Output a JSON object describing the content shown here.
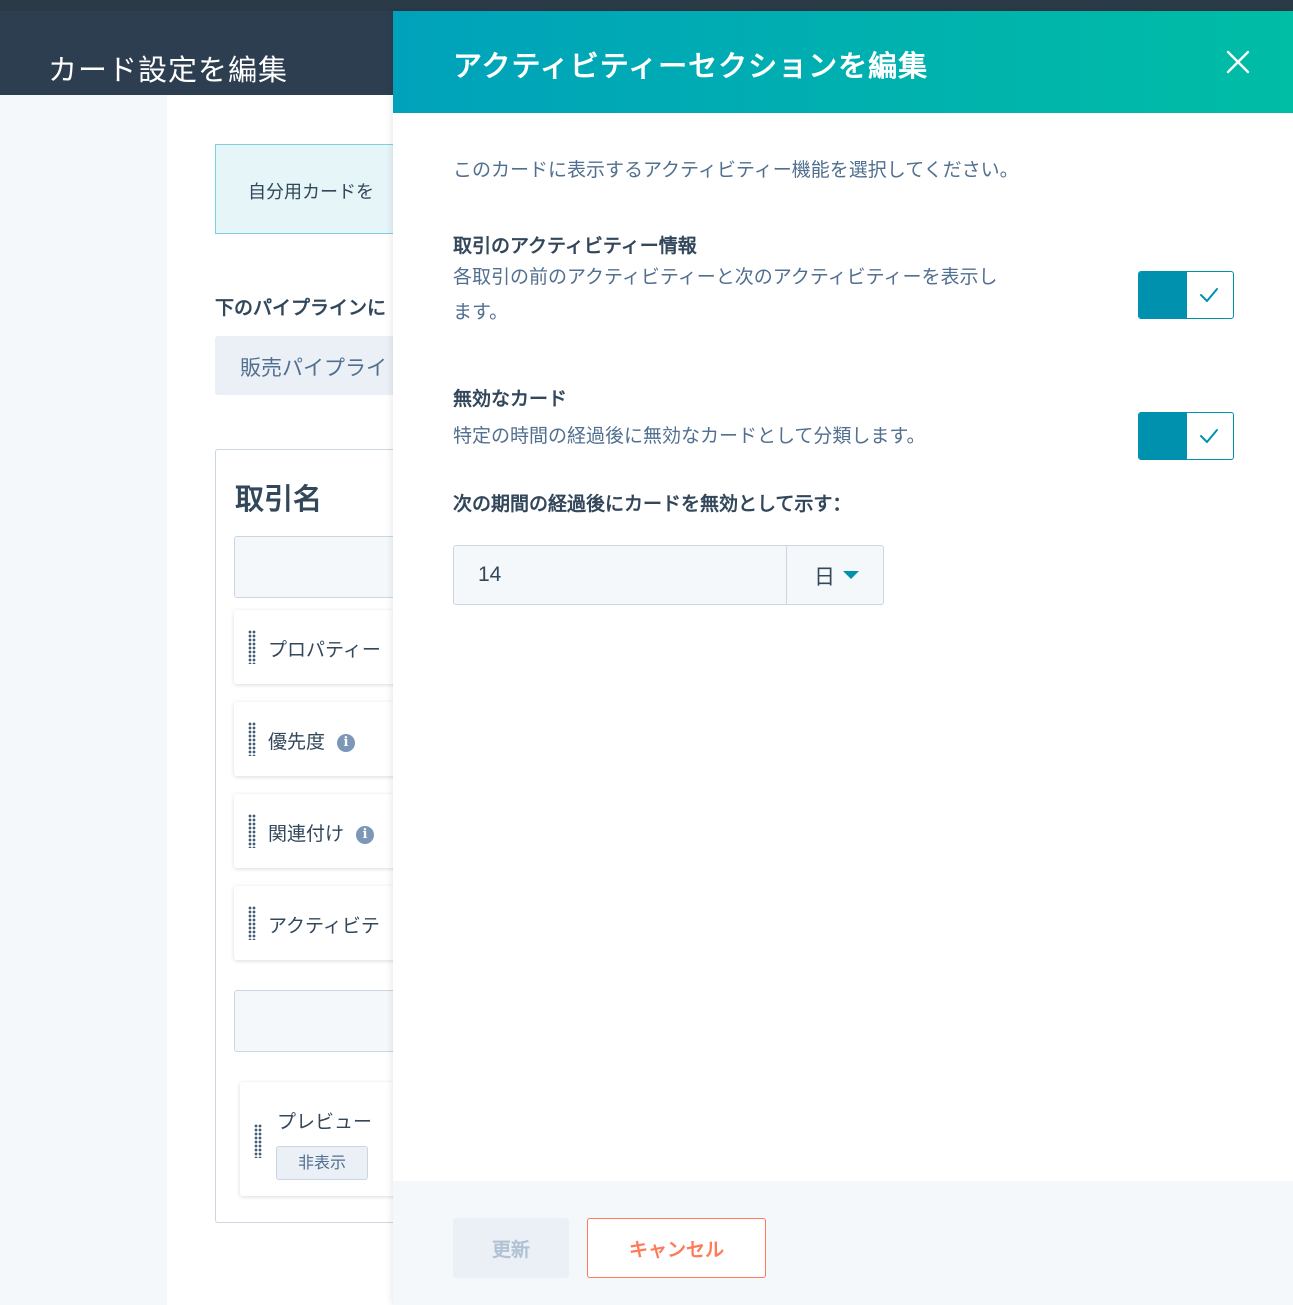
{
  "background": {
    "header_title": "カード設定を編集",
    "notice_text": "自分用カードを",
    "pipeline_label": "下のパイプラインに",
    "pipeline_select": "販売パイプライ",
    "card": {
      "title": "取引名",
      "rows": [
        {
          "label": "プロパティー",
          "info": false
        },
        {
          "label": "優先度",
          "info": true
        },
        {
          "label": "関連付け",
          "info": true
        },
        {
          "label": "アクティビテ",
          "info": false
        }
      ],
      "preview": {
        "label": "プレビュー",
        "badge": "非表示"
      }
    }
  },
  "panel": {
    "title": "アクティビティーセクションを編集",
    "intro": "このカードに表示するアクティビティー機能を選択してください。",
    "sections": [
      {
        "title": "取引のアクティビティー情報",
        "desc_line1": "各取引の前のアクティビティーと次のアクティビティーを表示し",
        "desc_line2": "ます。",
        "enabled": true
      },
      {
        "title": "無効なカード",
        "desc_line1": "特定の時間の経過後に無効なカードとして分類します。",
        "enabled": true
      }
    ],
    "period": {
      "label": "次の期間の経過後にカードを無効として示す：",
      "value": "14",
      "unit": "日"
    },
    "footer": {
      "update_label": "更新",
      "cancel_label": "キャンセル"
    }
  },
  "colors": {
    "header_gradient_start": "#00a2bb",
    "header_gradient_end": "#00bda5",
    "toggle_on": "#0091ae",
    "cancel_accent": "#ff7a59"
  }
}
